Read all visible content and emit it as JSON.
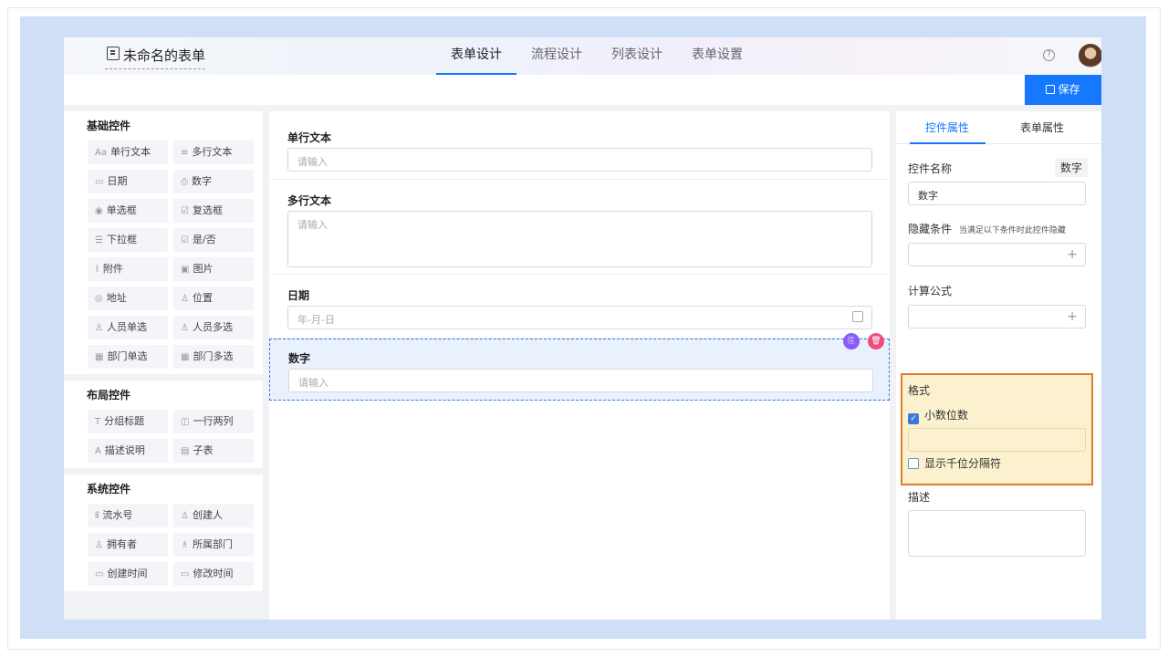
{
  "header": {
    "back_icon": "arrow-left-icon",
    "form_title": "未命名的表单",
    "tabs": [
      {
        "label": "表单设计",
        "active": true
      },
      {
        "label": "流程设计",
        "active": false
      },
      {
        "label": "列表设计",
        "active": false
      },
      {
        "label": "表单设置",
        "active": false
      }
    ],
    "help_glyph": "?"
  },
  "toolbar": {
    "save_label": "保存"
  },
  "palette": {
    "basic": {
      "title": "基础控件",
      "items": [
        {
          "label": "单行文本",
          "icon": "Aa"
        },
        {
          "label": "多行文本",
          "icon": "≡"
        },
        {
          "label": "日期",
          "icon": "▭"
        },
        {
          "label": "数字",
          "icon": "⎙"
        },
        {
          "label": "单选框",
          "icon": "◉"
        },
        {
          "label": "复选框",
          "icon": "☑"
        },
        {
          "label": "下拉框",
          "icon": "☰"
        },
        {
          "label": "是/否",
          "icon": "☑"
        },
        {
          "label": "附件",
          "icon": "⌇"
        },
        {
          "label": "图片",
          "icon": "▣"
        },
        {
          "label": "地址",
          "icon": "◎"
        },
        {
          "label": "位置",
          "icon": "♙"
        },
        {
          "label": "人员单选",
          "icon": "♙"
        },
        {
          "label": "人员多选",
          "icon": "♙"
        },
        {
          "label": "部门单选",
          "icon": "▦"
        },
        {
          "label": "部门多选",
          "icon": "▦"
        }
      ]
    },
    "layout": {
      "title": "布局控件",
      "items": [
        {
          "label": "分组标题",
          "icon": "T"
        },
        {
          "label": "一行两列",
          "icon": "◫"
        },
        {
          "label": "描述说明",
          "icon": "A"
        },
        {
          "label": "子表",
          "icon": "▤"
        }
      ]
    },
    "system": {
      "title": "系统控件",
      "items": [
        {
          "label": "流水号",
          "icon": "⦀"
        },
        {
          "label": "创建人",
          "icon": "♙"
        },
        {
          "label": "拥有者",
          "icon": "♙"
        },
        {
          "label": "所属部门",
          "icon": "♗"
        },
        {
          "label": "创建时间",
          "icon": "▭"
        },
        {
          "label": "修改时间",
          "icon": "▭"
        }
      ]
    }
  },
  "canvas": {
    "fields": [
      {
        "label": "单行文本",
        "placeholder": "请输入"
      },
      {
        "label": "多行文本",
        "placeholder": "请输入"
      },
      {
        "label": "日期",
        "placeholder": "年-月-日"
      },
      {
        "label": "数字",
        "placeholder": "请输入"
      }
    ],
    "actions": {
      "copy_icon": "copy-icon",
      "delete_icon": "trash-icon",
      "copy_color": "#8a5cf6",
      "delete_color": "#ee4d7a"
    }
  },
  "props": {
    "tabs": [
      {
        "label": "控件属性",
        "active": true
      },
      {
        "label": "表单属性",
        "active": false
      }
    ],
    "name_label": "控件名称",
    "name_tag": "数字",
    "name_value": "数字",
    "hide_label": "隐藏条件",
    "hide_hint": "当满足以下条件时此控件隐藏",
    "formula_label": "计算公式",
    "plus": "+",
    "format_label": "格式",
    "decimal_label": "小数位数",
    "decimal_checked": true,
    "decimal_value": "",
    "thousands_label": "显示千位分隔符",
    "thousands_checked": false,
    "desc_label": "描述",
    "desc_value": ""
  },
  "colors": {
    "accent": "#1677ff",
    "highlight_border": "#e07b2c",
    "highlight_bg": "#fbf1cf"
  }
}
